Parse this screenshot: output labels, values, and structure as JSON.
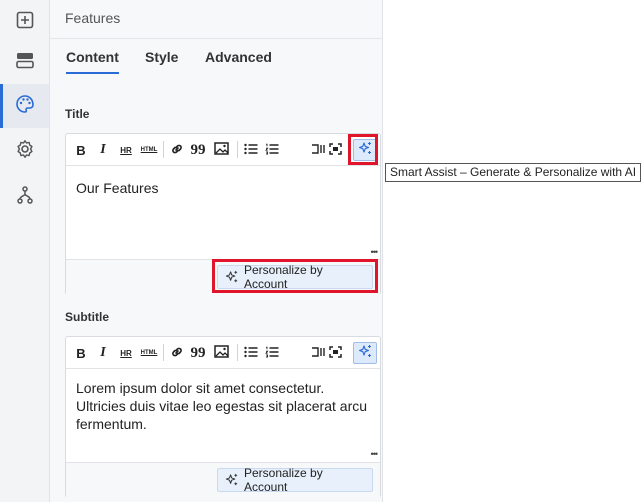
{
  "sidebar": {
    "items": [
      {
        "name": "add-icon"
      },
      {
        "name": "layout-icon"
      },
      {
        "name": "palette-icon",
        "active": true
      },
      {
        "name": "gear-icon"
      },
      {
        "name": "flow-icon"
      }
    ]
  },
  "panel": {
    "title": "Features",
    "tabs": [
      {
        "label": "Content",
        "active": true
      },
      {
        "label": "Style",
        "active": false
      },
      {
        "label": "Advanced",
        "active": false
      }
    ]
  },
  "toolbar": {
    "bold": "B",
    "italic": "I",
    "hr": "HR",
    "html": "HTML",
    "quote": "99",
    "smart_assist_tooltip": "Smart Assist – Generate & Personalize with AI"
  },
  "fields": {
    "title": {
      "label": "Title",
      "value": "Our Features",
      "personalize_label": "Personalize by Account"
    },
    "subtitle": {
      "label": "Subtitle",
      "value": "Lorem ipsum dolor sit amet consectetur. Ultricies duis vitae leo egestas sit placerat arcu fermentum.",
      "personalize_label": "Personalize by Account"
    }
  },
  "colors": {
    "accent": "#2a6bd6",
    "highlight": "#e0142b",
    "ai_icon": "#2a6bd6"
  }
}
